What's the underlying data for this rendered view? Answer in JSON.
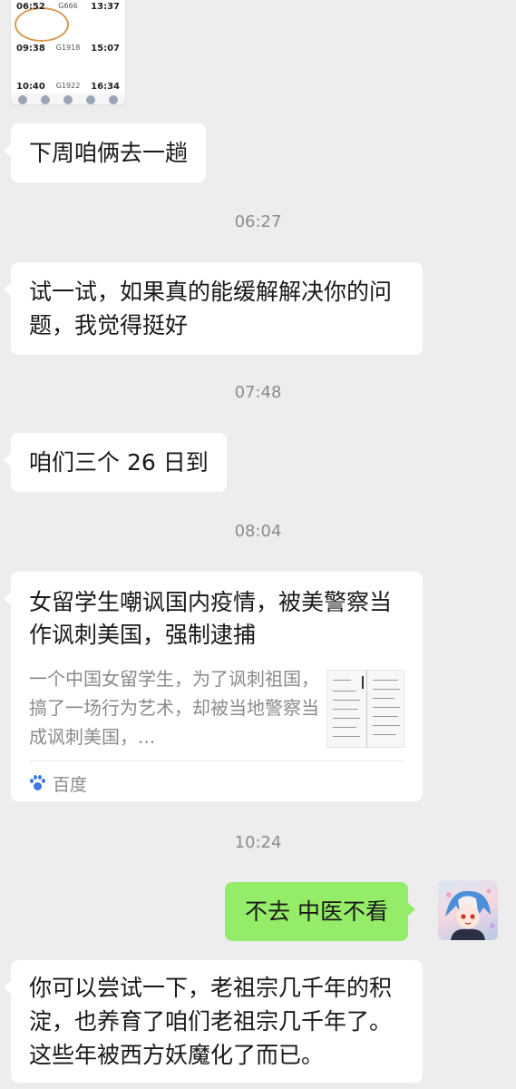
{
  "screenshot": {
    "rows": [
      {
        "left_time": "06:52",
        "mid": "G666",
        "right_time": "13:37"
      },
      {
        "left_time": "09:38",
        "mid": "G1918",
        "right_time": "15:07"
      },
      {
        "left_time": "10:40",
        "mid": "G1922",
        "right_time": "16:34"
      }
    ]
  },
  "messages": [
    {
      "text": "下周咱俩去一趟"
    },
    {
      "time": "06:27"
    },
    {
      "text": "试一试，如果真的能缓解解决你的问题，我觉得挺好"
    },
    {
      "time": "07:48"
    },
    {
      "text": "咱们三个 26 日到"
    },
    {
      "time": "08:04"
    },
    {
      "time": "10:24"
    },
    {
      "text": "不去 中医不看"
    },
    {
      "text": "你可以尝试一下，老祖宗几千年的积淀，也养育了咱们老祖宗几千年了。这些年被西方妖魔化了而已。"
    }
  ],
  "link_card": {
    "title": "女留学生嘲讽国内疫情，被美警察当作讽刺美国，强制逮捕",
    "summary": "一个中国女留学生，为了讽刺祖国，搞了一场行为艺术，却被当地警察当成讽刺美国，...",
    "source": "百度"
  },
  "colors": {
    "background": "#ededed",
    "incoming_bubble": "#ffffff",
    "outgoing_bubble": "#95ec69",
    "timestamp": "#8c8c8c",
    "source_icon": "#3b79e6"
  }
}
